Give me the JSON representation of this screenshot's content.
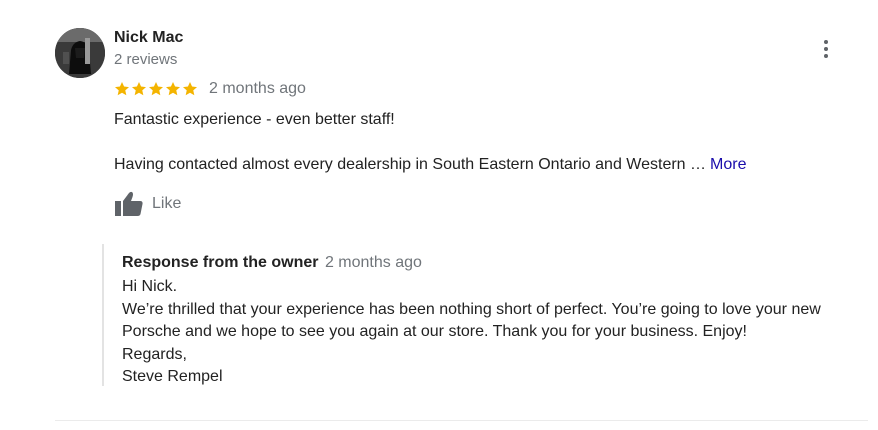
{
  "reviewer": {
    "name": "Nick Mac",
    "reviews_count": "2 reviews"
  },
  "review": {
    "rating": 5,
    "rating_max": 5,
    "time": "2 months ago",
    "title": "Fantastic experience - even better staff!",
    "body_excerpt": "Having contacted almost every dealership in South Eastern Ontario and Western …",
    "more_label": "More",
    "like_label": "Like"
  },
  "owner_response": {
    "title": "Response from the owner",
    "time": "2 months ago",
    "lines": [
      "Hi Nick.",
      "We’re thrilled that your experience has been nothing short of perfect. You’re going to love your new",
      "Porsche and we hope to see you again at our store. Thank you for your business. Enjoy!",
      "Regards,",
      "Steve Rempel"
    ]
  },
  "icons": {
    "menu": "more-vert-icon",
    "star": "star-icon",
    "like": "thumbs-up-icon"
  },
  "colors": {
    "star": "#f4b400",
    "link": "#1a0dab",
    "secondary_text": "#70757a"
  }
}
